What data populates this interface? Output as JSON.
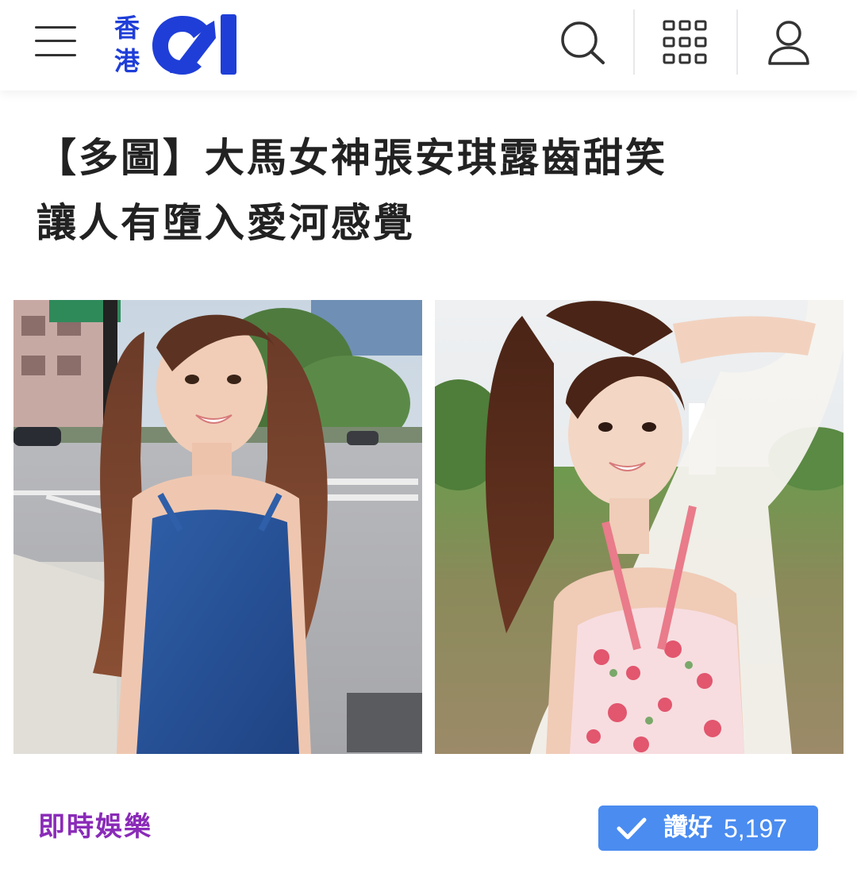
{
  "header": {
    "logo": {
      "chars_top": "香",
      "chars_bottom": "港",
      "mark": "01",
      "brand_color": "#1f3ed8"
    },
    "icons": [
      "menu-icon",
      "search-icon",
      "grid-apps-icon",
      "user-icon"
    ]
  },
  "article": {
    "title_line1": "【多圖】大馬女神張安琪露齒甜笑",
    "title_line2": "讓人有墮入愛河感覺",
    "category": "即時娛樂",
    "category_color": "#8a2bb8"
  },
  "like": {
    "label": "讚好",
    "count": "5,197",
    "color": "#4a8cf0"
  }
}
